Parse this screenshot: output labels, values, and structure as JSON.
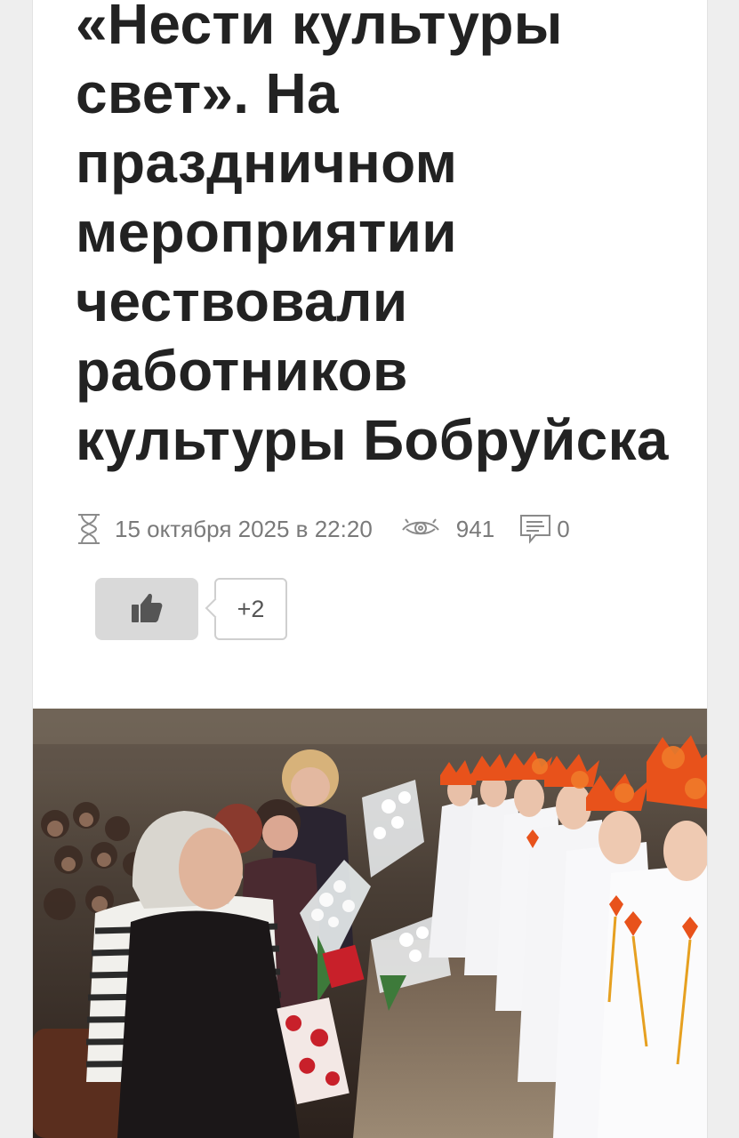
{
  "article": {
    "title_lines": [
      "«Нести культуры",
      "свет». На",
      "праздничном",
      "мероприятии",
      "чествовали",
      "работников",
      "культуры Бобруйска"
    ],
    "date": "15 октября 2025 в 22:20",
    "views": "941",
    "comments": "0",
    "likes": "+2",
    "icons": {
      "date": "hourglass-icon",
      "views": "eye-icon",
      "comments": "comment-icon",
      "like": "thumbs-up-icon"
    }
  },
  "colors": {
    "title": "#222222",
    "meta": "#7a7a7a",
    "like_button": "#d9d9d9",
    "leaf_accent": "#e8521b"
  }
}
